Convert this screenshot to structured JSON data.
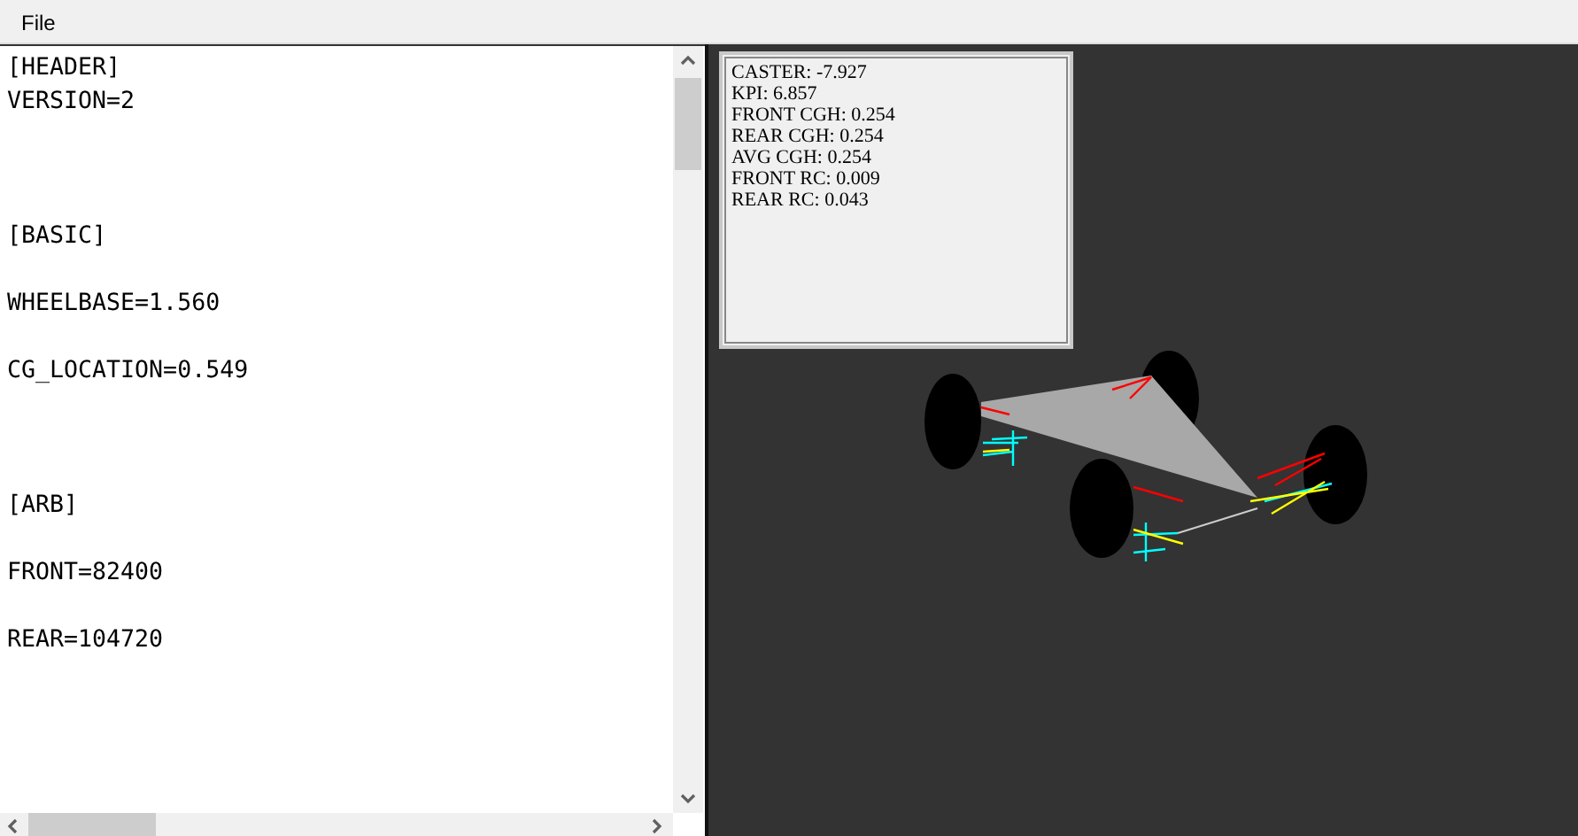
{
  "menu": [
    "File"
  ],
  "editor": {
    "text": "[HEADER]\nVERSION=2\n\n\n\n[BASIC]\n\nWHEELBASE=1.560\n\nCG_LOCATION=0.549\n\n\n\n[ARB]\n\nFRONT=82400\n\nREAR=104720"
  },
  "info_panel": {
    "lines": [
      "CASTER: -7.927",
      "KPI: 6.857",
      "FRONT CGH: 0.254",
      "REAR CGH: 0.254",
      "AVG CGH: 0.254",
      "FRONT RC: 0.009",
      "REAR RC: 0.043"
    ]
  }
}
